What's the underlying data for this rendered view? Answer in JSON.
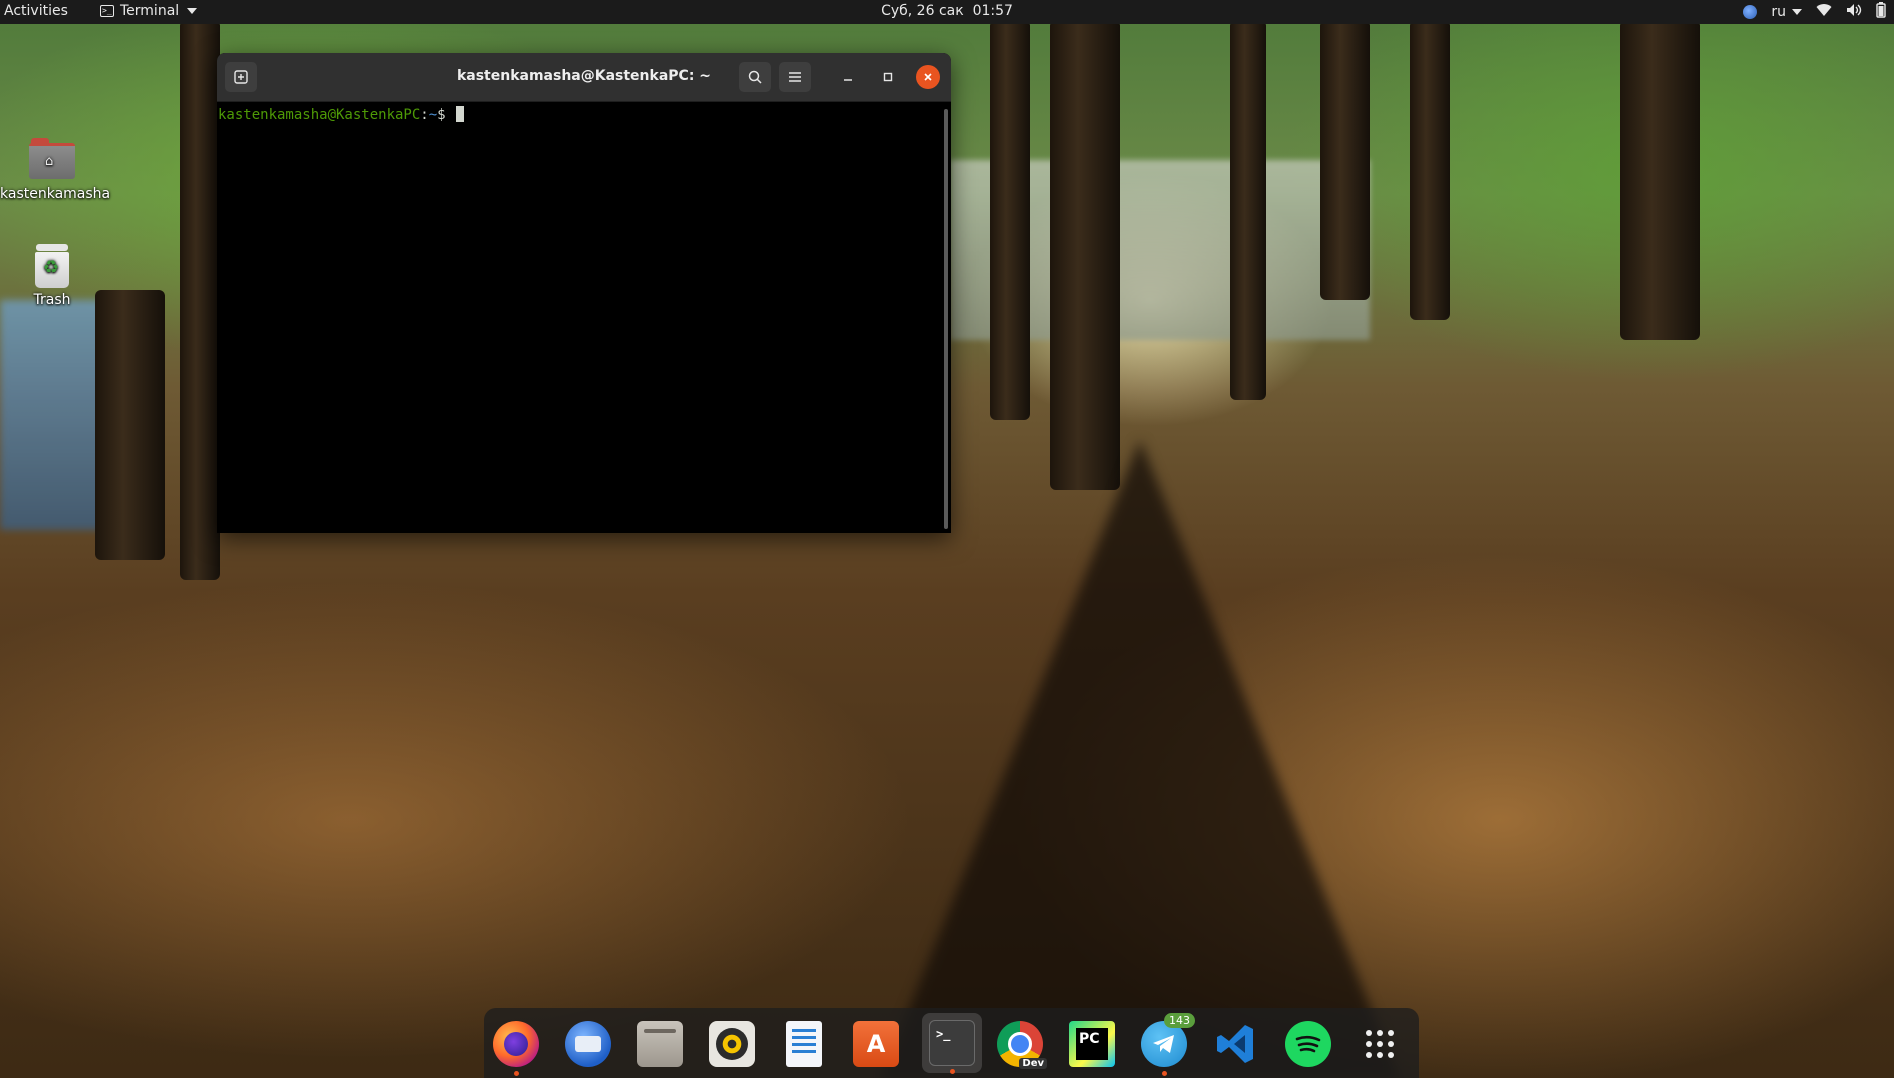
{
  "topbar": {
    "activities": "Activities",
    "app_menu": "Terminal",
    "clock": "Суб, 26 сак  01:57",
    "language": "ru"
  },
  "desktop": {
    "icons": [
      {
        "label": "kastenkamasha",
        "icon": "home-folder-icon"
      },
      {
        "label": "Trash",
        "icon": "trash-icon"
      }
    ]
  },
  "terminal": {
    "title": "kastenkamasha@KastenkaPC: ~",
    "prompt_user": "kastenkamasha@KastenkaPC",
    "prompt_colon": ":",
    "prompt_path": "~",
    "prompt_dollar": "$ ",
    "accent_close": "#e95420"
  },
  "dock": {
    "apps": [
      {
        "name": "Firefox",
        "icon": "firefox-icon",
        "running": true
      },
      {
        "name": "Thunderbird",
        "icon": "thunderbird-icon",
        "running": false
      },
      {
        "name": "Files",
        "icon": "files-icon",
        "running": false
      },
      {
        "name": "Rhythmbox",
        "icon": "rhythmbox-icon",
        "running": false
      },
      {
        "name": "LibreOffice Writer",
        "icon": "writer-icon",
        "running": false
      },
      {
        "name": "Ubuntu Software",
        "icon": "software-center-icon",
        "running": false
      },
      {
        "name": "Terminal",
        "icon": "terminal-icon",
        "running": true,
        "active": true
      },
      {
        "name": "Google Chrome Dev",
        "icon": "chrome-dev-icon",
        "label": "Dev",
        "running": false
      },
      {
        "name": "PyCharm",
        "icon": "pycharm-icon",
        "label": "PC",
        "running": false
      },
      {
        "name": "Telegram",
        "icon": "telegram-icon",
        "badge": "143",
        "running": true
      },
      {
        "name": "Visual Studio Code",
        "icon": "vscode-icon",
        "running": false
      },
      {
        "name": "Spotify",
        "icon": "spotify-icon",
        "running": false
      },
      {
        "name": "Show Applications",
        "icon": "app-grid-icon",
        "running": false
      }
    ]
  }
}
